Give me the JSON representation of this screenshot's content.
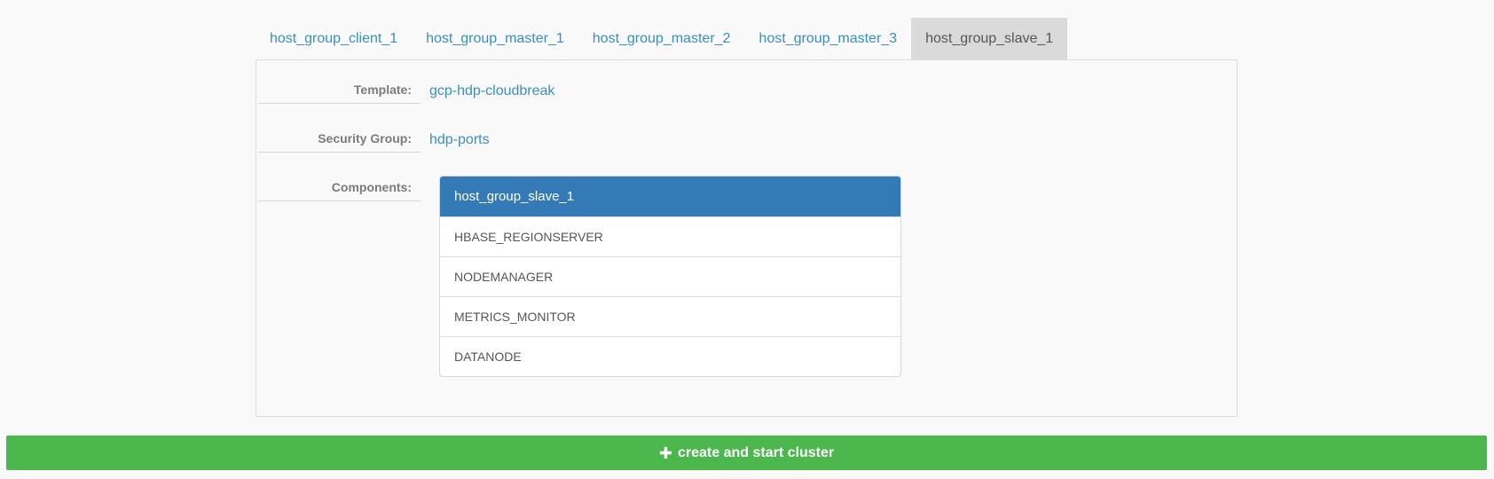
{
  "tabs": [
    {
      "label": "host_group_client_1",
      "active": false
    },
    {
      "label": "host_group_master_1",
      "active": false
    },
    {
      "label": "host_group_master_2",
      "active": false
    },
    {
      "label": "host_group_master_3",
      "active": false
    },
    {
      "label": "host_group_slave_1",
      "active": true
    }
  ],
  "details": {
    "template_label": "Template:",
    "template_value": "gcp-hdp-cloudbreak",
    "security_group_label": "Security Group:",
    "security_group_value": "hdp-ports",
    "components_label": "Components:"
  },
  "components": {
    "header": "host_group_slave_1",
    "items": [
      "HBASE_REGIONSERVER",
      "NODEMANAGER",
      "METRICS_MONITOR",
      "DATANODE"
    ]
  },
  "actions": {
    "create_label": "create and start cluster"
  },
  "colors": {
    "link": "#3a8fc0",
    "active_tab_bg": "#dadada",
    "list_header_bg": "#337ab7",
    "create_button_bg": "#4bb74c"
  }
}
